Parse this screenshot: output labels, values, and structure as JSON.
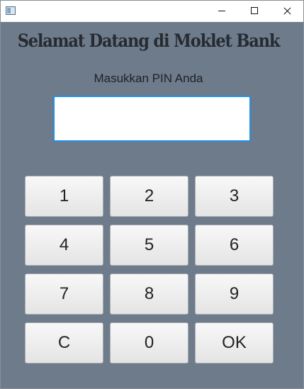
{
  "window": {
    "minimize_icon": "minimize-icon",
    "maximize_icon": "maximize-icon",
    "close_icon": "close-icon"
  },
  "main": {
    "welcome_title": "Selamat Datang di Moklet Bank",
    "pin_label": "Masukkan PIN Anda",
    "pin_value": ""
  },
  "keypad": {
    "keys": [
      "1",
      "2",
      "3",
      "4",
      "5",
      "6",
      "7",
      "8",
      "9",
      "C",
      "0",
      "OK"
    ]
  },
  "colors": {
    "background": "#6e7b8b",
    "input_focus_border": "#1e90e6"
  }
}
